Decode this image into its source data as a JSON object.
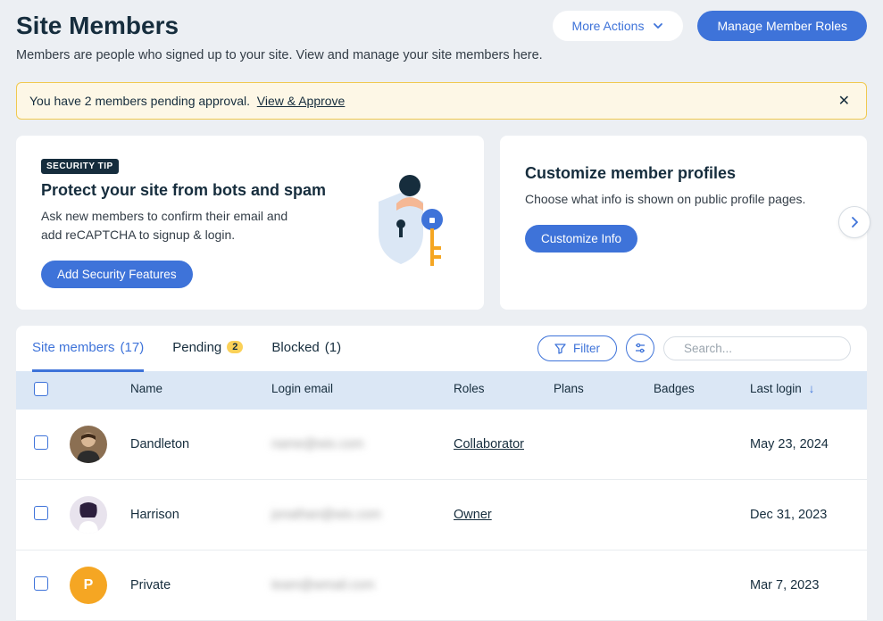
{
  "header": {
    "title": "Site Members",
    "subtitle": "Members are people who signed up to your site. View and manage your site members here.",
    "more_actions": "More Actions",
    "manage_roles": "Manage Member Roles"
  },
  "alert": {
    "text": "You have 2 members pending approval.",
    "link": "View & Approve"
  },
  "card_security": {
    "badge": "SECURITY TIP",
    "title": "Protect your site from bots and spam",
    "desc": "Ask new members to confirm their email and add reCAPTCHA to signup & login.",
    "button": "Add Security Features"
  },
  "card_customize": {
    "title": "Customize member profiles",
    "desc": "Choose what info is shown on public profile pages.",
    "button": "Customize Info"
  },
  "tabs": {
    "site_members": {
      "label": "Site members",
      "count": "(17)"
    },
    "pending": {
      "label": "Pending",
      "badge": "2"
    },
    "blocked": {
      "label": "Blocked",
      "count": "(1)"
    }
  },
  "filter_label": "Filter",
  "search_placeholder": "Search...",
  "columns": {
    "name": "Name",
    "email": "Login email",
    "roles": "Roles",
    "plans": "Plans",
    "badges": "Badges",
    "last_login": "Last login"
  },
  "rows": [
    {
      "name": "Dandleton",
      "email": "name@wix.com",
      "role": "Collaborator",
      "last_login": "May 23, 2024",
      "avatar_type": "photo1"
    },
    {
      "name": "Harrison",
      "email": "jonathan@wix.com",
      "role": "Owner",
      "last_login": "Dec 31, 2023",
      "avatar_type": "photo2"
    },
    {
      "name": "Private",
      "email": "team@wmail.com",
      "role": "",
      "last_login": "Mar 7, 2023",
      "avatar_type": "letter",
      "avatar_letter": "P",
      "avatar_color": "#f5a623"
    }
  ]
}
